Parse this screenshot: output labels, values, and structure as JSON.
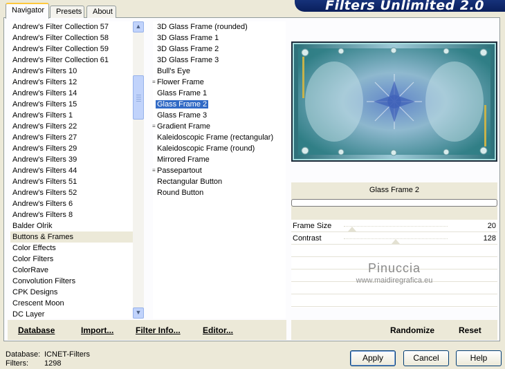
{
  "tabs": [
    {
      "label": "Navigator"
    },
    {
      "label": "Presets"
    },
    {
      "label": "About"
    }
  ],
  "banner": {
    "title": "Filters Unlimited 2.0"
  },
  "categories": [
    "Andrew's Filter Collection 57",
    "Andrew's Filter Collection 58",
    "Andrew's Filter Collection 59",
    "Andrew's Filter Collection 61",
    "Andrew's Filters 10",
    "Andrew's Filters 12",
    "Andrew's Filters 14",
    "Andrew's Filters 15",
    "Andrew's Filters 1",
    "Andrew's Filters 22",
    "Andrew's Filters 27",
    "Andrew's Filters 29",
    "Andrew's Filters 39",
    "Andrew's Filters 44",
    "Andrew's Filters 51",
    "Andrew's Filters 52",
    "Andrew's Filters 6",
    "Andrew's Filters 8",
    "Balder Olrik",
    "Buttons & Frames",
    "Color Effects",
    "Color Filters",
    "ColorRave",
    "Convolution Filters",
    "CPK Designs",
    "Crescent Moon",
    "DC Layer"
  ],
  "selected_category": "Buttons & Frames",
  "filters": [
    {
      "label": "3D Glass Frame (rounded)",
      "grip": false
    },
    {
      "label": "3D Glass Frame 1",
      "grip": false
    },
    {
      "label": "3D Glass Frame 2",
      "grip": false
    },
    {
      "label": "3D Glass Frame 3",
      "grip": false
    },
    {
      "label": "Bull's Eye",
      "grip": false
    },
    {
      "label": "Flower Frame",
      "grip": true
    },
    {
      "label": "Glass Frame 1",
      "grip": false
    },
    {
      "label": "Glass Frame 2",
      "grip": false
    },
    {
      "label": "Glass Frame 3",
      "grip": false
    },
    {
      "label": "Gradient Frame",
      "grip": true
    },
    {
      "label": "Kaleidoscopic Frame (rectangular)",
      "grip": false
    },
    {
      "label": "Kaleidoscopic Frame (round)",
      "grip": false
    },
    {
      "label": "Mirrored Frame",
      "grip": false
    },
    {
      "label": "Passepartout",
      "grip": true
    },
    {
      "label": "Rectangular Button",
      "grip": false
    },
    {
      "label": "Round Button",
      "grip": false
    }
  ],
  "selected_filter": "Glass Frame 2",
  "toolbar": {
    "database": "Database",
    "import": "Import...",
    "filter_info": "Filter Info...",
    "editor": "Editor..."
  },
  "preview_title": "Glass Frame 2",
  "params": [
    {
      "label": "Frame Size",
      "value": "20",
      "level": 0.078
    },
    {
      "label": "Contrast",
      "value": "128",
      "level": 0.5
    }
  ],
  "watermark": {
    "line1": "Pinuccia",
    "line2": "www.maidiregrafica.eu"
  },
  "actions": {
    "randomize": "Randomize",
    "reset": "Reset"
  },
  "status": {
    "database_label": "Database:",
    "database_value": "ICNET-Filters",
    "filters_label": "Filters:",
    "filters_value": "1298"
  },
  "buttons": {
    "apply": "Apply",
    "cancel": "Cancel",
    "help": "Help"
  },
  "colors": {
    "selection": "#316ac5",
    "banner": "#16327a",
    "preview_border": "#1d2b3a"
  }
}
